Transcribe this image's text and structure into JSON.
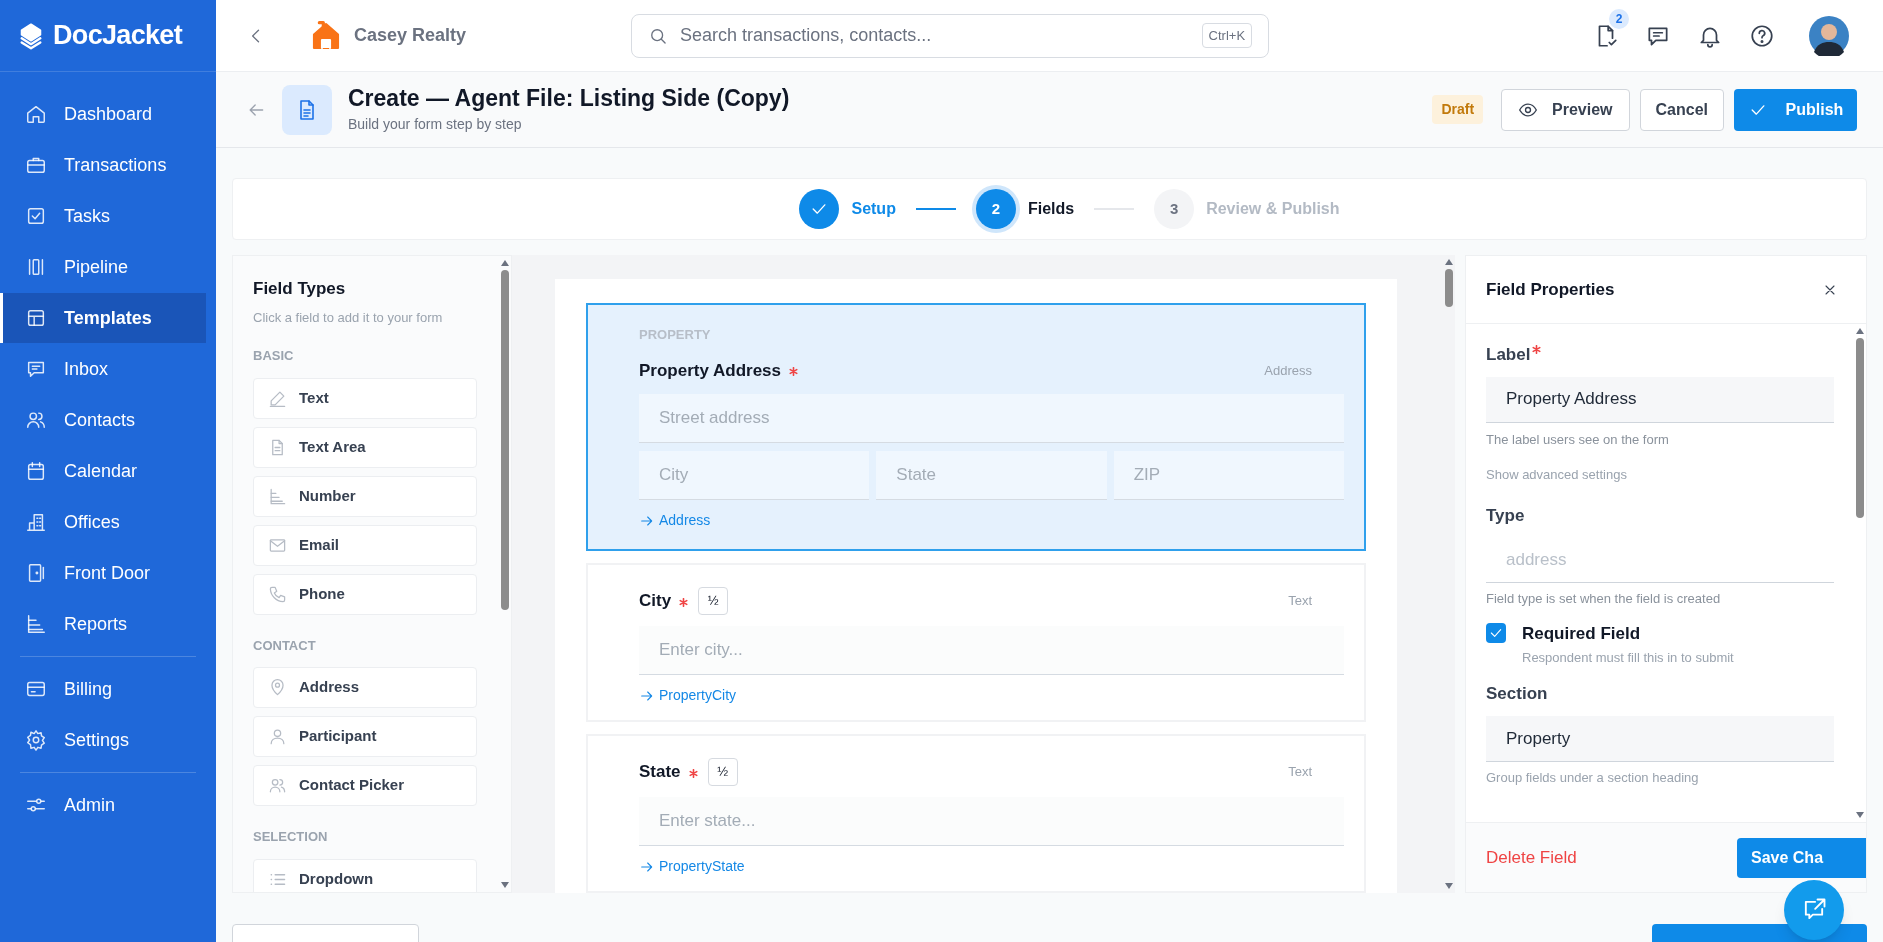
{
  "sidebar": {
    "logo": "DocJacket",
    "groups": [
      [
        {
          "label": "Dashboard",
          "selected": false
        },
        {
          "label": "Transactions",
          "selected": false
        },
        {
          "label": "Tasks",
          "selected": false
        },
        {
          "label": "Pipeline",
          "selected": false
        },
        {
          "label": "Templates",
          "selected": true
        },
        {
          "label": "Inbox",
          "selected": false
        },
        {
          "label": "Contacts",
          "selected": false
        },
        {
          "label": "Calendar",
          "selected": false
        },
        {
          "label": "Offices",
          "selected": false
        },
        {
          "label": "Front Door",
          "selected": false
        },
        {
          "label": "Reports",
          "selected": false
        }
      ],
      [
        {
          "label": "Billing",
          "selected": false
        },
        {
          "label": "Settings",
          "selected": false
        }
      ],
      [
        {
          "label": "Admin",
          "selected": false
        }
      ]
    ]
  },
  "topbar": {
    "company": "Casey Realty",
    "search": {
      "placeholder": "Search transactions, contacts...",
      "shortcut": "Ctrl+K"
    },
    "task_count": "2"
  },
  "header": {
    "title": "Create — Agent File: Listing Side (Copy)",
    "subtitle": "Build your form step by step",
    "status": "Draft",
    "buttons": [
      {
        "label": "Preview",
        "kind": "preview"
      },
      {
        "label": "Cancel",
        "kind": "plain"
      },
      {
        "label": "Publish",
        "kind": "primary"
      }
    ]
  },
  "stepper": [
    {
      "label": "Setup",
      "completed": true,
      "selected": false
    },
    {
      "number": "2",
      "label": "Fields",
      "completed": false,
      "selected": true
    },
    {
      "number": "3",
      "label": "Review & Publish",
      "completed": false,
      "selected": false
    }
  ],
  "field_types": {
    "title": "Field Types",
    "hint": "Click a field to add it to your form",
    "groups": [
      {
        "heading": "BASIC",
        "items": [
          "Text",
          "Text Area",
          "Number",
          "Email",
          "Phone"
        ]
      },
      {
        "heading": "CONTACT",
        "items": [
          "Address",
          "Participant",
          "Contact Picker"
        ]
      },
      {
        "heading": "SELECTION",
        "items": [
          "Dropdown"
        ]
      }
    ]
  },
  "form_fields": [
    {
      "kind": "address",
      "section": "PROPERTY",
      "label": "Property Address",
      "required": true,
      "type_label": "Address",
      "placeholders": [
        "Street address",
        "City",
        "State",
        "ZIP"
      ],
      "binding": "Address",
      "selected": true
    },
    {
      "kind": "text",
      "label": "City",
      "required": true,
      "width_badge": "½",
      "type_label": "Text",
      "placeholder": "Enter city...",
      "binding": "PropertyCity",
      "selected": false
    },
    {
      "kind": "text",
      "label": "State",
      "required": true,
      "width_badge": "½",
      "type_label": "Text",
      "placeholder": "Enter state...",
      "binding": "PropertyState",
      "selected": false
    }
  ],
  "properties": {
    "title": "Field Properties",
    "label": {
      "name": "Label",
      "required": true,
      "value": "Property Address",
      "help": "The label users see on the form"
    },
    "advanced_link": "Show advanced settings",
    "type": {
      "name": "Type",
      "value": "address",
      "disabled": true,
      "help": "Field type is set when the field is created"
    },
    "required_field": {
      "label": "Required Field",
      "checked": true,
      "help": "Respondent must fill this in to submit"
    },
    "section": {
      "name": "Section",
      "value": "Property",
      "help": "Group fields under a section heading"
    },
    "delete_label": "Delete Field",
    "save_label": "Save Cha"
  }
}
